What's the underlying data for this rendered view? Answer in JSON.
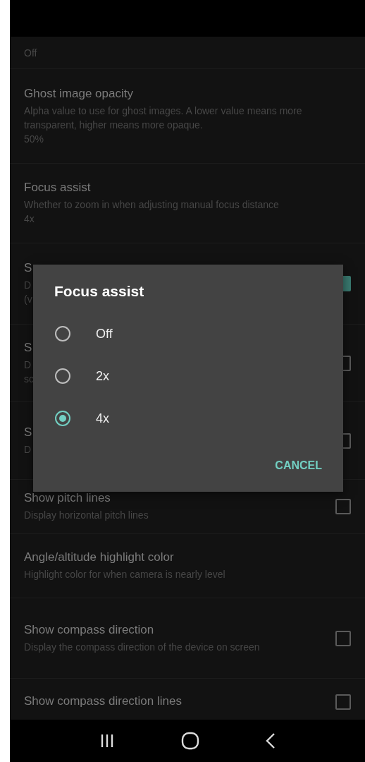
{
  "settings": [
    {
      "kind": "value",
      "value": "Off"
    },
    {
      "kind": "value",
      "title": "Ghost image opacity",
      "description": "Alpha value to use for ghost images. A lower value means more transparent, higher means more opaque.",
      "value": "50%"
    },
    {
      "kind": "value",
      "title": "Focus assist",
      "description": "Whether to zoom in when adjusting manual focus distance",
      "value": "4x"
    },
    {
      "kind": "checkbox",
      "title": "S",
      "description": "D\n(v",
      "checked": true
    },
    {
      "kind": "checkbox",
      "title": "S",
      "description": "D\nsc",
      "checked": false
    },
    {
      "kind": "checkbox",
      "title": "S",
      "description": "D",
      "checked": false
    },
    {
      "kind": "checkbox",
      "title": "Show pitch lines",
      "description": "Display horizontal pitch lines",
      "checked": false
    },
    {
      "kind": "plain",
      "title": "Angle/altitude highlight color",
      "description": "Highlight color for when camera is nearly level"
    },
    {
      "kind": "checkbox",
      "title": "Show compass direction",
      "description": "Display the compass direction of the device on screen",
      "checked": false
    },
    {
      "kind": "checkbox",
      "title": "Show compass direction lines",
      "checked": false
    }
  ],
  "dialog": {
    "title": "Focus assist",
    "options": [
      {
        "label": "Off",
        "selected": false
      },
      {
        "label": "2x",
        "selected": false
      },
      {
        "label": "4x",
        "selected": true
      }
    ],
    "cancel": "CANCEL"
  }
}
